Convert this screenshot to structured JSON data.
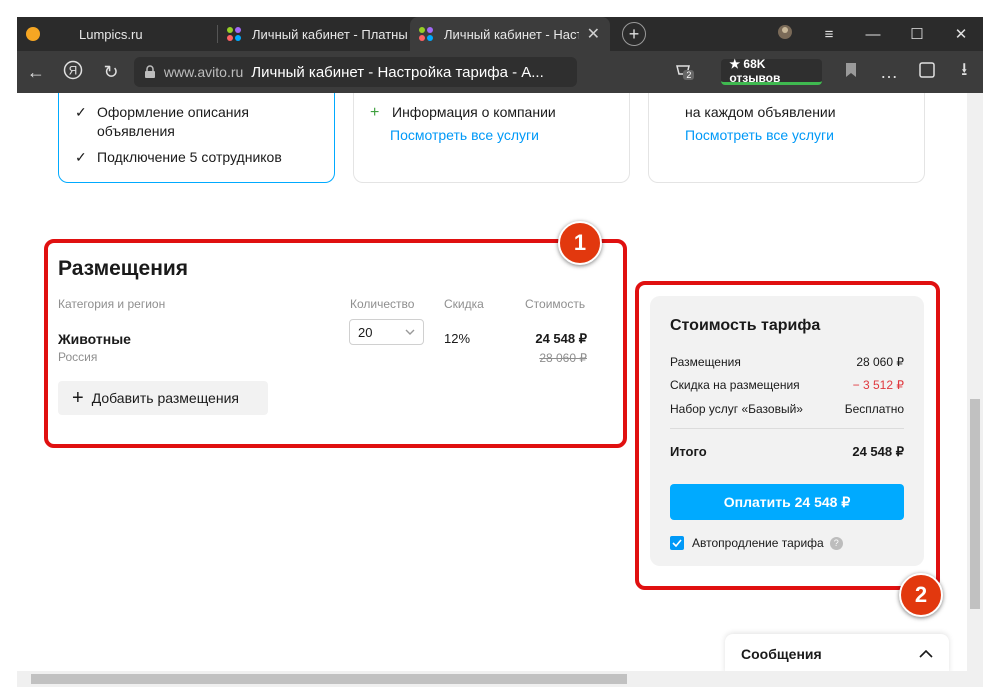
{
  "browser": {
    "tabs": [
      {
        "label": "Lumpics.ru",
        "favicon": "lumpics-favicon"
      },
      {
        "label": "Личный кабинет - Платны",
        "favicon": "avito-favicon"
      },
      {
        "label": "Личный кабинет - Наст",
        "favicon": "avito-favicon",
        "active": true
      }
    ],
    "new_tab": "+",
    "window_controls": {
      "menu": "≡",
      "minimize": "—",
      "maximize": "☐",
      "close": "✕"
    },
    "address": {
      "domain": "www.avito.ru",
      "page_title": "Личный кабинет - Настройка тарифа - А...",
      "downloads_count": "2",
      "reviews": "★ 68K отзывов"
    }
  },
  "tariff_cards": [
    {
      "features": [
        "Оформление описания",
        "объявления",
        "Подключение 5 сотрудников"
      ]
    },
    {
      "features": [
        "Информация о компании"
      ],
      "link": "Посмотреть все услуги"
    },
    {
      "features": [
        "на каждом объявлении"
      ],
      "link": "Посмотреть все услуги"
    }
  ],
  "placements": {
    "title": "Размещения",
    "headers": {
      "category": "Категория и регион",
      "quantity": "Количество",
      "discount": "Скидка",
      "cost": "Стоимость"
    },
    "row": {
      "category": "Животные",
      "region": "Россия",
      "quantity": "20",
      "discount": "12%",
      "cost": "24 548 ₽",
      "old_cost": "28 060 ₽"
    },
    "add_button": "Добавить размещения"
  },
  "summary": {
    "title": "Стоимость тарифа",
    "rows": [
      {
        "label": "Размещения",
        "value": "28 060 ₽"
      },
      {
        "label": "Скидка на размещения",
        "value": "− 3 512 ₽"
      },
      {
        "label": "Набор услуг «Базовый»",
        "value": "Бесплатно"
      }
    ],
    "total_label": "Итого",
    "total_value": "24 548 ₽",
    "pay_button": "Оплатить 24 548 ₽",
    "autorenew_label": "Автопродление тарифа",
    "help": "?"
  },
  "annotations": {
    "badge1": "1",
    "badge2": "2"
  },
  "messages": {
    "label": "Сообщения"
  },
  "colors": {
    "accent": "#00aaff",
    "annotation_red": "#e01010",
    "discount_red": "#e0383e"
  }
}
